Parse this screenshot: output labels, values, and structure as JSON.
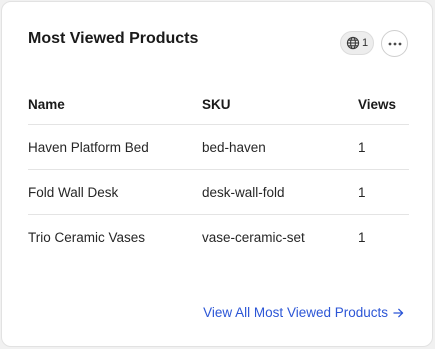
{
  "card": {
    "title": "Most Viewed Products",
    "scope_badge": {
      "icon": "globe-icon",
      "count": "1"
    },
    "more_button": {
      "icon": "more-horizontal-icon"
    }
  },
  "table": {
    "columns": [
      "Name",
      "SKU",
      "Views"
    ],
    "rows": [
      {
        "name": "Haven Platform Bed",
        "sku": "bed-haven",
        "views": "1"
      },
      {
        "name": "Fold Wall Desk",
        "sku": "desk-wall-fold",
        "views": "1"
      },
      {
        "name": "Trio Ceramic Vases",
        "sku": "vase-ceramic-set",
        "views": "1"
      }
    ]
  },
  "footer": {
    "view_all_label": "View All Most Viewed Products",
    "arrow_icon": "arrow-right-icon"
  },
  "colors": {
    "link": "#2c56d6",
    "card_background": "#ffffff",
    "page_background": "#f1f1f1"
  }
}
